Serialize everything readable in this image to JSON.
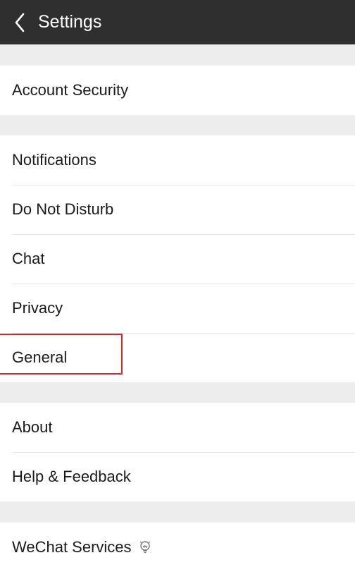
{
  "header": {
    "title": "Settings",
    "back_icon": "chevron-left-icon"
  },
  "sections": [
    {
      "items": [
        "Account Security"
      ]
    },
    {
      "items": [
        "Notifications",
        "Do Not Disturb",
        "Chat",
        "Privacy",
        "General"
      ]
    },
    {
      "items": [
        "About",
        "Help & Feedback"
      ]
    },
    {
      "items": [
        "WeChat Services"
      ]
    }
  ],
  "services_icon": "lightbulb-icon",
  "colors": {
    "header_bg": "#2f2f2f",
    "page_bg": "#ededed",
    "highlight": "#d42a2a"
  }
}
